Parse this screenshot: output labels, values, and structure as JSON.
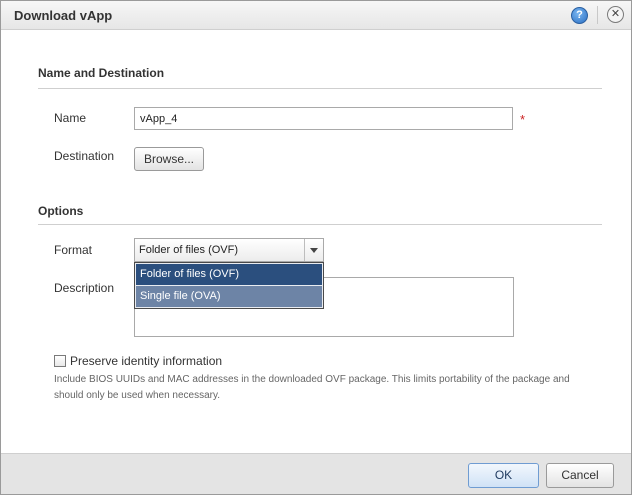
{
  "dialog": {
    "title": "Download vApp",
    "help_icon": "help-icon",
    "help_glyph": "?",
    "close_icon": "close-icon",
    "close_glyph": "✕"
  },
  "name_destination": {
    "section_title": "Name and Destination",
    "name_label": "Name",
    "name_value": "vApp_4",
    "required_marker": "*",
    "destination_label": "Destination",
    "browse_label": "Browse..."
  },
  "options": {
    "section_title": "Options",
    "format_label": "Format",
    "format_selected": "Folder of files (OVF)",
    "format_options": [
      "Folder of files (OVF)",
      "Single file (OVA)"
    ],
    "description_label": "Description",
    "description_value": ""
  },
  "preserve": {
    "label": "Preserve identity information",
    "checked": false,
    "help_text": "Include BIOS UUIDs and MAC addresses in the downloaded OVF package. This limits portability of the package and should only be used when necessary."
  },
  "footer": {
    "ok_label": "OK",
    "cancel_label": "Cancel"
  },
  "colors": {
    "selected_option": "#2b4f7e",
    "hover_option": "#6d84a6",
    "required": "#cc2222",
    "ok_border": "#6f9cd2"
  }
}
